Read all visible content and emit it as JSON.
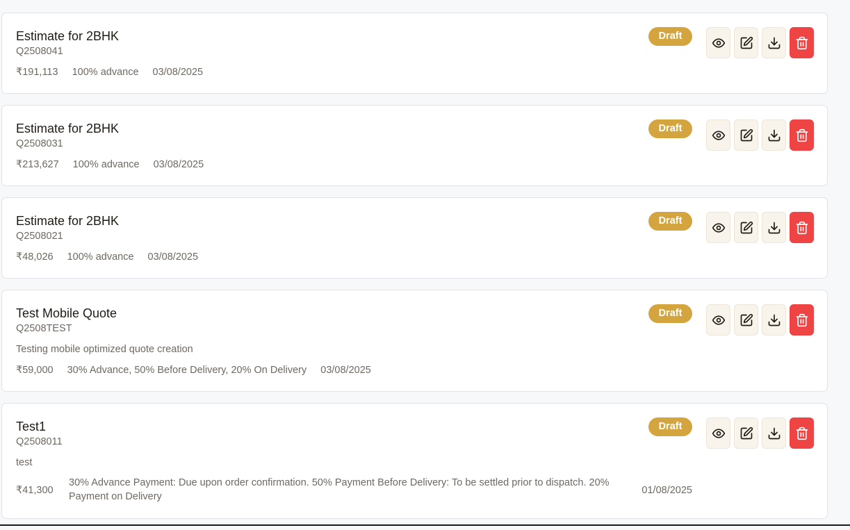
{
  "quotes": [
    {
      "title": "Estimate for 2BHK",
      "code": "Q2508041",
      "description": "",
      "amount": "₹191,113",
      "payment_terms": "100% advance",
      "date": "03/08/2025",
      "status": "Draft"
    },
    {
      "title": "Estimate for 2BHK",
      "code": "Q2508031",
      "description": "",
      "amount": "₹213,627",
      "payment_terms": "100% advance",
      "date": "03/08/2025",
      "status": "Draft"
    },
    {
      "title": "Estimate for 2BHK",
      "code": "Q2508021",
      "description": "",
      "amount": "₹48,026",
      "payment_terms": "100% advance",
      "date": "03/08/2025",
      "status": "Draft"
    },
    {
      "title": "Test Mobile Quote",
      "code": "Q2508TEST",
      "description": "Testing mobile optimized quote creation",
      "amount": "₹59,000",
      "payment_terms": "30% Advance, 50% Before Delivery, 20% On Delivery",
      "date": "03/08/2025",
      "status": "Draft"
    },
    {
      "title": "Test1",
      "code": "Q2508011",
      "description": "test",
      "amount": "₹41,300",
      "payment_terms": "30% Advance Payment: Due upon order confirmation. 50% Payment Before Delivery: To be settled prior to dispatch. 20% Payment on Delivery",
      "date": "01/08/2025",
      "status": "Draft"
    }
  ],
  "actions": [
    {
      "name": "view",
      "icon": "eye-icon"
    },
    {
      "name": "edit",
      "icon": "edit-icon"
    },
    {
      "name": "download",
      "icon": "download-icon"
    },
    {
      "name": "delete",
      "icon": "trash-icon"
    }
  ],
  "colors": {
    "badge_draft": "#d4a43e",
    "delete_button": "#ef4444",
    "action_button_bg": "#f8f4ec"
  }
}
